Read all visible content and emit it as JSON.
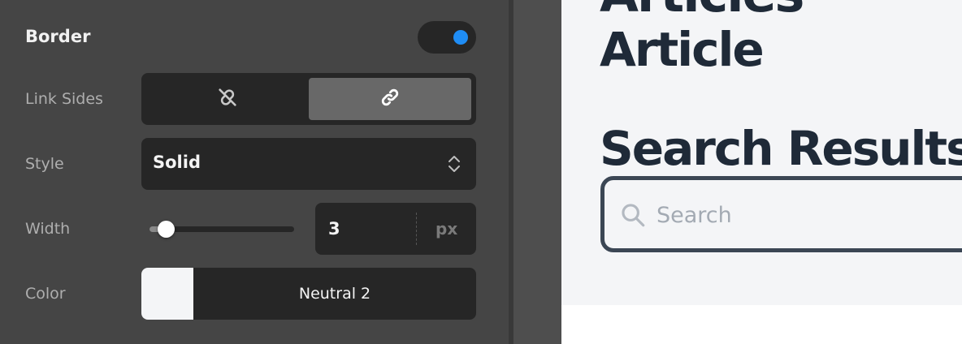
{
  "border_panel": {
    "title": "Border",
    "enabled": true,
    "link_sides": {
      "label": "Link Sides",
      "options": [
        "unlink-icon",
        "link-icon"
      ],
      "selected": "link-icon"
    },
    "style": {
      "label": "Style",
      "value": "Solid"
    },
    "width": {
      "label": "Width",
      "value": "3",
      "unit": "px",
      "slider_fraction": 0.06
    },
    "color": {
      "label": "Color",
      "name": "Neutral 2",
      "swatch": "#f4f5f7"
    }
  },
  "canvas": {
    "heading_partial": "Articles",
    "heading_article": "Article",
    "heading_search": "Search Results",
    "search": {
      "placeholder": "Search",
      "value": ""
    }
  },
  "colors": {
    "panel_bg": "#454545",
    "control_bg": "#262626",
    "toggle_on": "#1f8df5",
    "heading_text": "#1f2a38",
    "search_border": "#3b4654"
  }
}
